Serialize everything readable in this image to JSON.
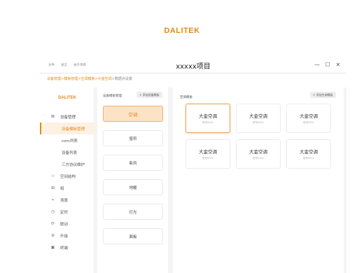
{
  "brand": {
    "name": "DALITEK",
    "color": "#e08a1e"
  },
  "menu": [
    "文件",
    "语言",
    "关于项目"
  ],
  "window": {
    "title": "xxxxx项目",
    "controls": [
      "—",
      "☐",
      "✕"
    ]
  },
  "breadcrumb": {
    "links": [
      "设备管理",
      "模板管理",
      "空调模板",
      "大金空调"
    ],
    "current": "数据点设置",
    "separator": ">"
  },
  "sidebar": {
    "logo": "DALITEK",
    "items": [
      {
        "label": "设备管理",
        "icon": "device-icon",
        "glyph": "⊠",
        "expanded": true
      },
      {
        "label": "设备模板管理",
        "sub": true,
        "active": true
      },
      {
        "label": "com列表",
        "sub": true
      },
      {
        "label": "设备列表",
        "sub": true
      },
      {
        "label": "三方协议维护",
        "sub": true
      },
      {
        "label": "空间结构",
        "icon": "star-icon",
        "glyph": "☆"
      },
      {
        "label": "组",
        "icon": "group-icon",
        "glyph": "⊞"
      },
      {
        "label": "场景",
        "icon": "send-icon",
        "glyph": "➢"
      },
      {
        "label": "定时",
        "icon": "clock-icon",
        "glyph": "◷"
      },
      {
        "label": "联动",
        "icon": "link-icon",
        "glyph": "⟳"
      },
      {
        "label": "升级",
        "icon": "upgrade-icon",
        "glyph": "⊛"
      },
      {
        "label": "终端",
        "icon": "terminal-icon",
        "glyph": "▣"
      }
    ]
  },
  "middle": {
    "header": "设备模板管理",
    "add_button": "+ 添加设备模板",
    "items": [
      "空调",
      "窗帘",
      "新风",
      "地暖",
      "灯光",
      "面板"
    ],
    "active_index": 0
  },
  "right": {
    "header": "空调模板",
    "add_button": "+ 添加空调模板",
    "cards": [
      {
        "name": "大金空调",
        "model": "型号0001",
        "active": true
      },
      {
        "name": "大金空调",
        "model": "型号0001"
      },
      {
        "name": "大金空调",
        "model": "型号0001"
      },
      {
        "name": "大金空调",
        "model": "型号0001"
      },
      {
        "name": "大金空调",
        "model": "型号0001"
      },
      {
        "name": "大金空调",
        "model": "型号0001"
      }
    ]
  }
}
